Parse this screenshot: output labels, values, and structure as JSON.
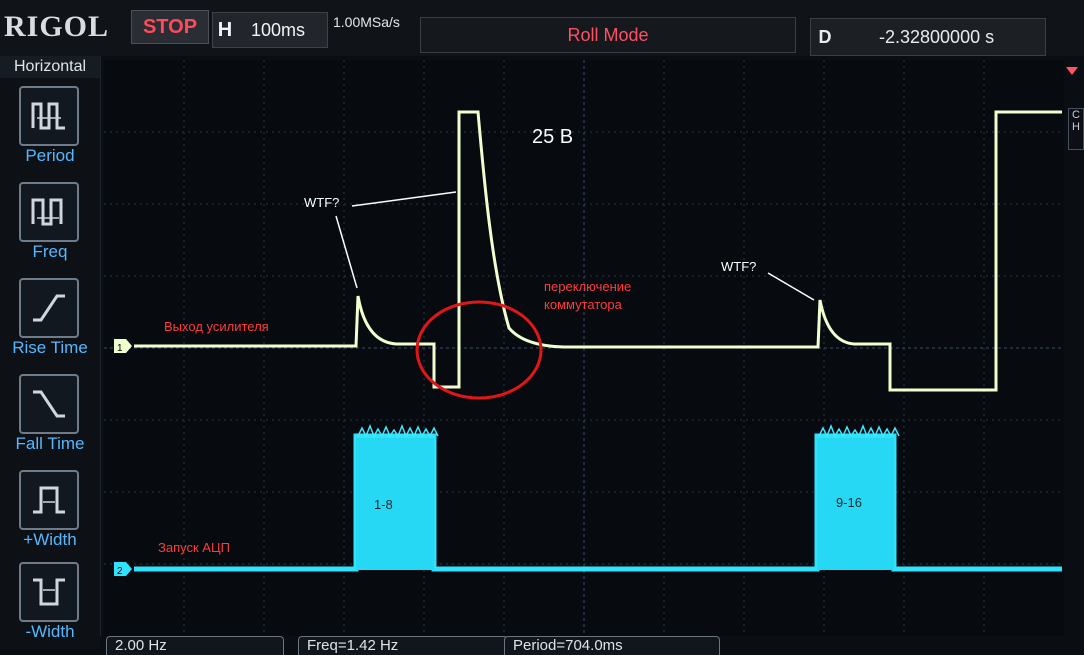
{
  "header": {
    "brand": "RIGOL",
    "run_state": "STOP",
    "timebase_tag": "H",
    "timebase": "100ms",
    "sample_rate": "1.00MSa/s",
    "mode": "Roll Mode",
    "delay_tag": "D",
    "delay": "-2.32800000 s"
  },
  "sidebar": {
    "title": "Horizontal",
    "items": [
      {
        "label": "Period",
        "icon": "period-icon"
      },
      {
        "label": "Freq",
        "icon": "frequency-icon"
      },
      {
        "label": "Rise Time",
        "icon": "rise-time-icon"
      },
      {
        "label": "Fall Time",
        "icon": "fall-time-icon"
      },
      {
        "label": "+Width",
        "icon": "positive-width-icon"
      },
      {
        "label": "-Width",
        "icon": "negative-width-icon"
      }
    ]
  },
  "channels": [
    {
      "marker": "1",
      "label": "Выход усилителя",
      "color": "#f4ffd1"
    },
    {
      "marker": "2",
      "label": "Запуск АЦП",
      "color": "#27e6ff"
    }
  ],
  "annotations": {
    "voltage": "25 В",
    "wtf_left": "WTF?",
    "wtf_right": "WTF?",
    "switch_line1": "переключение",
    "switch_line2": "коммутатора",
    "burst_a": "1-8",
    "burst_b": "9-16"
  },
  "colors": {
    "ch1_trace": "#f1ffd0",
    "ch2_trace": "#2fe3ff",
    "annotation_red": "#ff3b3b",
    "circle_red": "#e21616",
    "grid": "#2a3a50"
  },
  "measurements_bar": {
    "m1": "2.00 Hz",
    "m2": "Freq=1.42 Hz",
    "m3": "Period=704.0ms"
  },
  "right_tag": "C\nH"
}
